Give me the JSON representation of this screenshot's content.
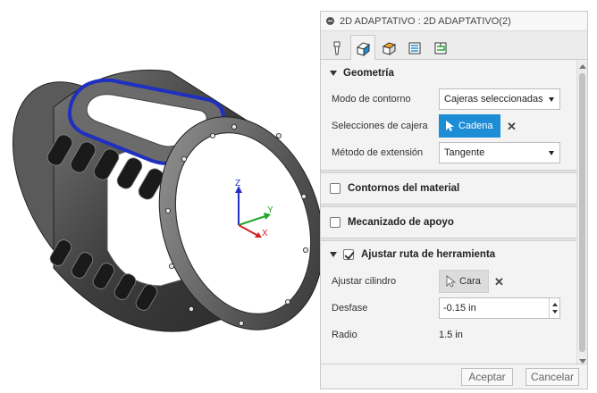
{
  "panel": {
    "title": "2D ADAPTATIVO : 2D ADAPTATIVO(2)",
    "tabs": [
      {
        "icon": "tool-icon"
      },
      {
        "icon": "geometry-icon"
      },
      {
        "icon": "heights-icon"
      },
      {
        "icon": "passes-icon"
      },
      {
        "icon": "linking-icon"
      }
    ],
    "geometria": {
      "title": "Geometría",
      "modo_label": "Modo de contorno",
      "modo_value": "Cajeras seleccionadas",
      "selecciones_label": "Selecciones de cajera",
      "selecciones_value": "Cadena",
      "metodo_label": "Método de extensión",
      "metodo_value": "Tangente"
    },
    "contornos": {
      "title": "Contornos del material",
      "checked": false
    },
    "mecanizado": {
      "title": "Mecanizado de apoyo",
      "checked": false
    },
    "ajustar": {
      "title": "Ajustar ruta de herramienta",
      "checked": true,
      "cilindro_label": "Ajustar cilindro",
      "cilindro_value": "Cara",
      "desfase_label": "Desfase",
      "desfase_value": "-0.15 in",
      "radio_label": "Radio",
      "radio_value": "1.5 in"
    },
    "buttons": {
      "accept": "Aceptar",
      "cancel": "Cancelar"
    }
  },
  "viewport": {
    "triad": {
      "z": "Z",
      "y": "Y",
      "x": "X"
    },
    "colors": {
      "selection": "#1f2fbf",
      "body": "#3a3a3a",
      "x": "#d61f1f",
      "y": "#1fa82a",
      "z": "#2430c4"
    }
  }
}
